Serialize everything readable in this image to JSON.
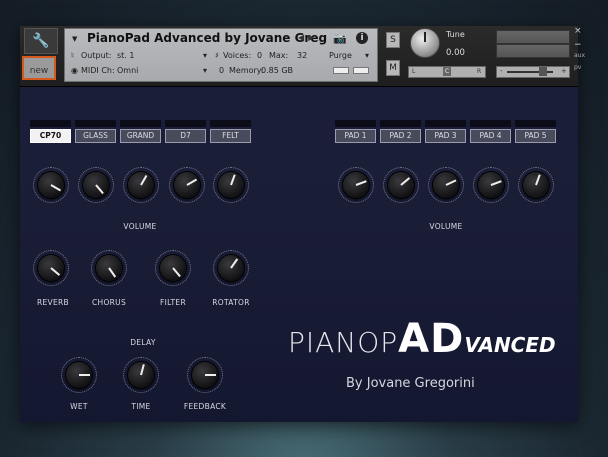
{
  "header": {
    "instrument_title": "PianoPad Advanced by Jovane Greg",
    "new_label": "new",
    "output_label": "Output:",
    "output_value": "st. 1",
    "voices_label": "Voices:",
    "voices_value": "0",
    "max_label": "Max:",
    "max_value": "32",
    "purge_label": "Purge",
    "midi_label": "MIDI Ch:",
    "midi_value": "Omni",
    "memory_label": "Memory:",
    "memory_value": "0.85 GB",
    "memory_count": "0",
    "s_label": "S",
    "m_label": "M",
    "tune_label": "Tune",
    "tune_value": "0.00",
    "pan_left": "L",
    "pan_right": "R",
    "pan_center": "C",
    "vol_minus": "-",
    "vol_plus": "+",
    "aux_label": "aux",
    "pv_label": "pv",
    "close": "×",
    "minimize": "−"
  },
  "piano_buttons": [
    {
      "label": "CP70",
      "active": true
    },
    {
      "label": "GLASS",
      "active": false
    },
    {
      "label": "GRAND",
      "active": false
    },
    {
      "label": "D7",
      "active": false
    },
    {
      "label": "FELT",
      "active": false
    }
  ],
  "pad_buttons": [
    {
      "label": "PAD 1"
    },
    {
      "label": "PAD 2"
    },
    {
      "label": "PAD 3"
    },
    {
      "label": "PAD 4"
    },
    {
      "label": "PAD 5"
    }
  ],
  "labels": {
    "piano_volume": "VOLUME",
    "pad_volume": "VOLUME",
    "reverb": "REVERB",
    "chorus": "CHORUS",
    "filter": "FILTER",
    "rotator": "ROTATOR",
    "delay": "DELAY",
    "wet": "WET",
    "time": "TIME",
    "feedback": "FEEDBACK"
  },
  "logo": {
    "part1": "PIANOP",
    "part2": "AD",
    "part3": "VANCED",
    "byline": "By Jovane Gregorini"
  }
}
